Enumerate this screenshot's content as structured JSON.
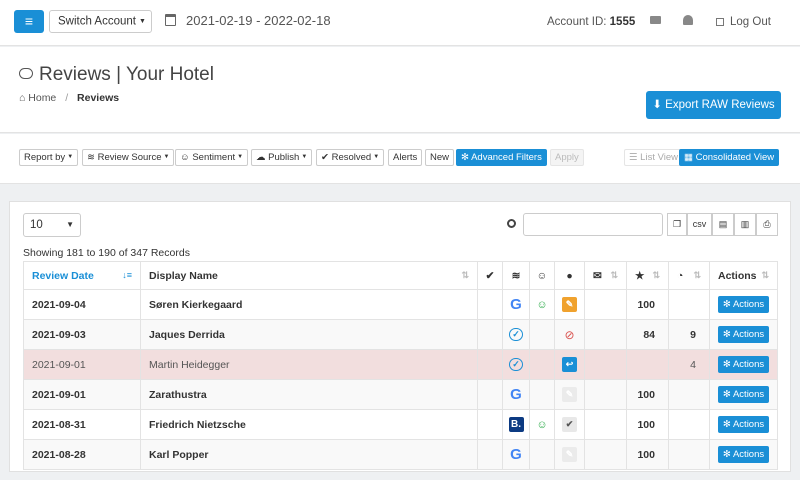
{
  "topbar": {
    "switch_account": "Switch Account",
    "date_range": "2021-02-19 - 2022-02-18",
    "account_label": "Account ID:",
    "account_id": "1555",
    "logout": "Log Out"
  },
  "header": {
    "title": "Reviews | Your Hotel",
    "breadcrumb_home": "Home",
    "breadcrumb_sep": "/",
    "breadcrumb_current": "Reviews",
    "export_button": "Export RAW Reviews"
  },
  "toolbar": {
    "report_by": "Report by",
    "review_source": "Review Source",
    "sentiment": "Sentiment",
    "publish": "Publish",
    "resolved": "Resolved",
    "alerts": "Alerts",
    "new": "New",
    "advanced_filters": "Advanced Filters",
    "apply": "Apply",
    "list_view": "List View",
    "consolidated_view": "Consolidated View"
  },
  "table": {
    "page_size": "10",
    "csv_label": "csv",
    "showing": "Showing 181 to 190 of 347 Records",
    "columns": {
      "review_date": "Review Date",
      "display_name": "Display Name",
      "actions": "Actions"
    },
    "action_label": "Actions",
    "rows": [
      {
        "date": "2021-09-04",
        "name": "Søren Kierkegaard",
        "source": "google",
        "sentiment": "positive",
        "publish": "orange",
        "score": "100",
        "time": ""
      },
      {
        "date": "2021-09-03",
        "name": "Jaques Derrida",
        "source": "cloud",
        "sentiment": "",
        "publish": "ban",
        "score": "84",
        "time": "9"
      },
      {
        "date": "2021-09-01",
        "name": "Martin Heidegger",
        "source": "cloud",
        "sentiment": "",
        "publish": "reply",
        "score": "",
        "time": "4"
      },
      {
        "date": "2021-09-01",
        "name": "Zarathustra",
        "source": "google",
        "sentiment": "",
        "publish": "light",
        "score": "100",
        "time": ""
      },
      {
        "date": "2021-08-31",
        "name": "Friedrich Nietzsche",
        "source": "booking",
        "sentiment": "positive",
        "publish": "check",
        "score": "100",
        "time": ""
      },
      {
        "date": "2021-08-28",
        "name": "Karl Popper",
        "source": "google",
        "sentiment": "",
        "publish": "light",
        "score": "100",
        "time": ""
      }
    ]
  },
  "colors": {
    "accent": "#1a8fd6",
    "highlight_row": "#f2dede",
    "positive": "#27a844",
    "danger": "#d9534f"
  }
}
